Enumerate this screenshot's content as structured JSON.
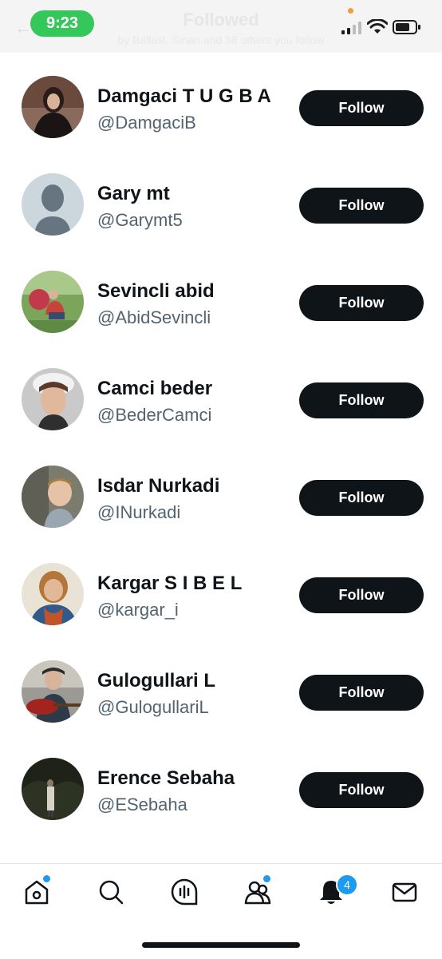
{
  "status_bar": {
    "time": "9:23"
  },
  "header": {
    "title": "Followed",
    "subtitle": "by Ballasl, Sinan and 38 others you follow"
  },
  "follow_label": "Follow",
  "users": [
    {
      "name": "Damgaci T U G B A",
      "handle": "@DamgaciB"
    },
    {
      "name": "Gary mt",
      "handle": "@Garymt5"
    },
    {
      "name": "Sevincli abid",
      "handle": "@AbidSevincli"
    },
    {
      "name": "Camci beder",
      "handle": "@BederCamci"
    },
    {
      "name": "Isdar Nurkadi",
      "handle": "@INurkadi"
    },
    {
      "name": "Kargar S I B E L",
      "handle": "@kargar_i"
    },
    {
      "name": "Gulogullari L",
      "handle": "@GulogullariL"
    },
    {
      "name": "Erence Sebaha",
      "handle": "@ESebaha"
    }
  ],
  "nav": {
    "items": [
      "home-icon",
      "search-icon",
      "spaces-icon",
      "communities-icon",
      "notifications-icon",
      "messages-icon"
    ],
    "notifications_badge": "4"
  },
  "colors": {
    "button": "#0f1419",
    "accent": "#1d9bf0",
    "handle": "#536471",
    "time_pill": "#34c759"
  }
}
